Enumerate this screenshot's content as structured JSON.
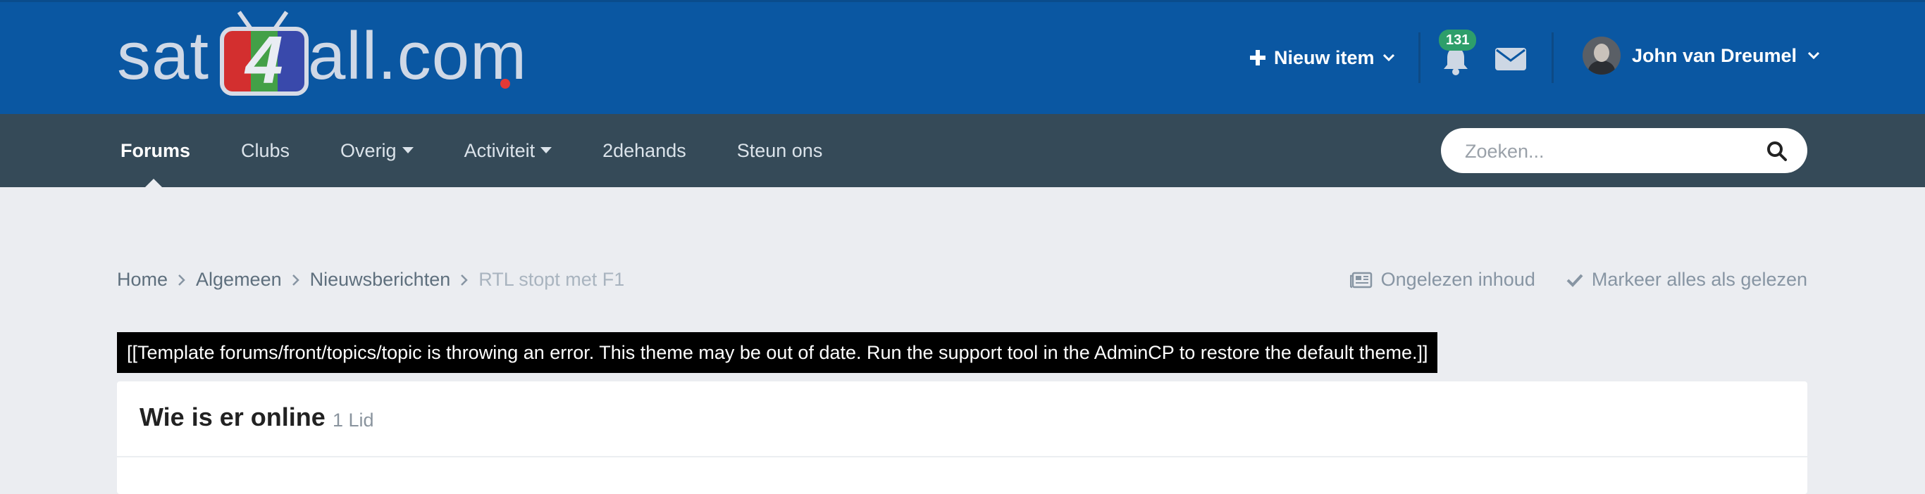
{
  "header": {
    "logo_text_left": "sat",
    "logo_tv_char": "4",
    "logo_text_right": "all.com",
    "new_item_label": "Nieuw item",
    "notifications_count": "131",
    "user_name": "John van Dreumel"
  },
  "nav": {
    "items": [
      {
        "label": "Forums",
        "dropdown": false
      },
      {
        "label": "Clubs",
        "dropdown": false
      },
      {
        "label": "Overig",
        "dropdown": true
      },
      {
        "label": "Activiteit",
        "dropdown": true
      },
      {
        "label": "2dehands",
        "dropdown": false
      },
      {
        "label": "Steun ons",
        "dropdown": false
      }
    ],
    "search_placeholder": "Zoeken..."
  },
  "breadcrumb": {
    "items": [
      "Home",
      "Algemeen",
      "Nieuwsberichten"
    ],
    "current": "RTL stopt met F1"
  },
  "actions": {
    "unread": "Ongelezen inhoud",
    "mark_read": "Markeer alles als gelezen"
  },
  "error_message": "[[Template forums/front/topics/topic is throwing an error. This theme may be out of date. Run the support tool in the AdminCP to restore the default theme.]]",
  "online_panel": {
    "title": "Wie is er online",
    "count": "1 Lid"
  },
  "colors": {
    "header_bg": "#0a57a2",
    "navbar_bg": "#354a58",
    "page_bg": "#ebedf1",
    "badge": "#2e9e6a"
  }
}
